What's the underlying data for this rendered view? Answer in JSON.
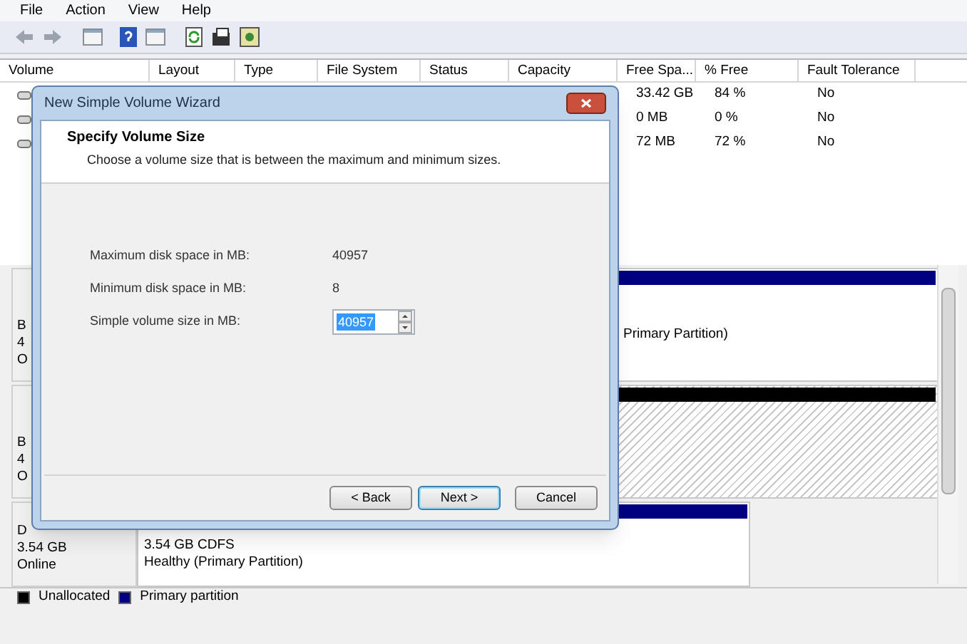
{
  "menu": [
    "File",
    "Action",
    "View",
    "Help"
  ],
  "table": {
    "columns": [
      "Volume",
      "Layout",
      "Type",
      "File System",
      "Status",
      "Capacity",
      "Free Spa...",
      "% Free",
      "Fault Tolerance"
    ],
    "rows": [
      {
        "free_space": "33.42 GB",
        "percent_free": "84 %",
        "fault_tolerance": "No"
      },
      {
        "free_space": "0 MB",
        "percent_free": "0 %",
        "fault_tolerance": "No"
      },
      {
        "free_space": "72 MB",
        "percent_free": "72 %",
        "fault_tolerance": "No"
      }
    ]
  },
  "disks": [
    {
      "lines": [
        "B",
        "4",
        "O"
      ],
      "partition": {
        "kind": "primary",
        "lines": [
          "Primary Partition)"
        ]
      }
    },
    {
      "lines": [
        "B",
        "4",
        "O"
      ],
      "partition": {
        "kind": "unallocated"
      }
    },
    {
      "lines": [
        "D",
        "3.54 GB",
        "Online"
      ],
      "partition": {
        "kind": "primary",
        "lines": [
          "3.54 GB CDFS",
          "Healthy (Primary Partition)"
        ]
      }
    }
  ],
  "legend": [
    {
      "label": "Unallocated",
      "color": "#000000"
    },
    {
      "label": "Primary partition",
      "color": "#000080"
    }
  ],
  "dialog": {
    "title": "New Simple Volume Wizard",
    "heading": "Specify Volume Size",
    "subtitle": "Choose a volume size that is between the maximum and minimum sizes.",
    "fields": [
      {
        "kind": "text",
        "label": "Maximum disk space in MB:",
        "value": "40957"
      },
      {
        "kind": "text",
        "label": "Minimum disk space in MB:",
        "value": "8"
      },
      {
        "kind": "spin",
        "label": "Simple volume size in MB:",
        "value": "40957"
      }
    ],
    "buttons": [
      {
        "label": "< Back",
        "default": false
      },
      {
        "label": "Next >",
        "default": true
      },
      {
        "label": "Cancel",
        "default": false
      }
    ]
  }
}
